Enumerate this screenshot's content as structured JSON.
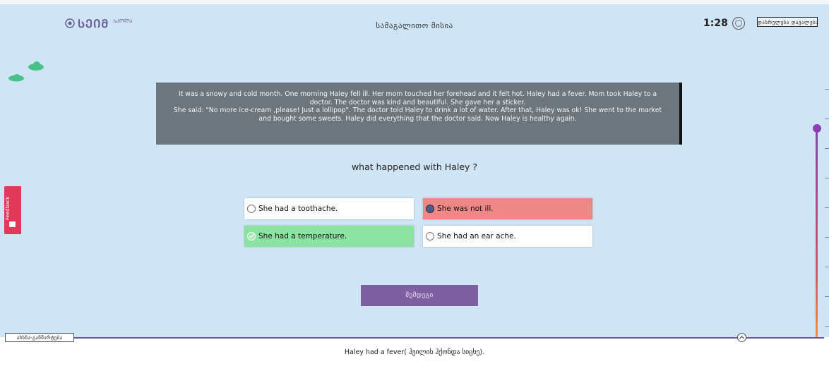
{
  "header": {
    "logo_text": "ᲡᲔᲘᲛ",
    "logo_sub": "ᲡᲙᲝᲚᲐ",
    "page_title": "სამაგალითო მისია",
    "timer": "1:28",
    "end_button": "დასრულება დავალებაში"
  },
  "passage": {
    "paragraph_1": "It was a snowy and cold month. One morning Haley fell ill. Her mom touched her forehead and it felt hot. Haley had a fever. Mom took Haley to a doctor. The doctor was kind and beautiful. She gave her a sticker.",
    "paragraph_2": "She said: \"No more ice-cream ,please! Just a lollipop\". The doctor told Haley to drink a lot of water. After that, Haley was ok! She went to the market and bought some sweets. Haley did everything that the doctor said. Now Haley is healthy again."
  },
  "question": "what happened with Haley ?",
  "answers": [
    {
      "label": "She had a toothache.",
      "state": "default"
    },
    {
      "label": "She was not ill.",
      "state": "selected-wrong"
    },
    {
      "label": "She had a temperature.",
      "state": "correct"
    },
    {
      "label": "She had an ear ache.",
      "state": "default"
    }
  ],
  "next_button": "შემდეგი",
  "feedback_label": "Feedback",
  "explanation": {
    "tab_label": "ახსნა-განმარტება",
    "text": "Haley had a fever( ჰეილის ჰქონდა სიცხე)."
  },
  "colors": {
    "background": "#cfe4f4",
    "passage_bg": "#6e767d",
    "wrong": "#f08787",
    "correct": "#8ce3a1",
    "accent": "#7e5fa0",
    "feedback": "#e2395a"
  },
  "icons": [
    "logo-icon",
    "timer-icon",
    "cloud-icon",
    "check-icon",
    "chevron-up-icon",
    "feedback-icon"
  ]
}
